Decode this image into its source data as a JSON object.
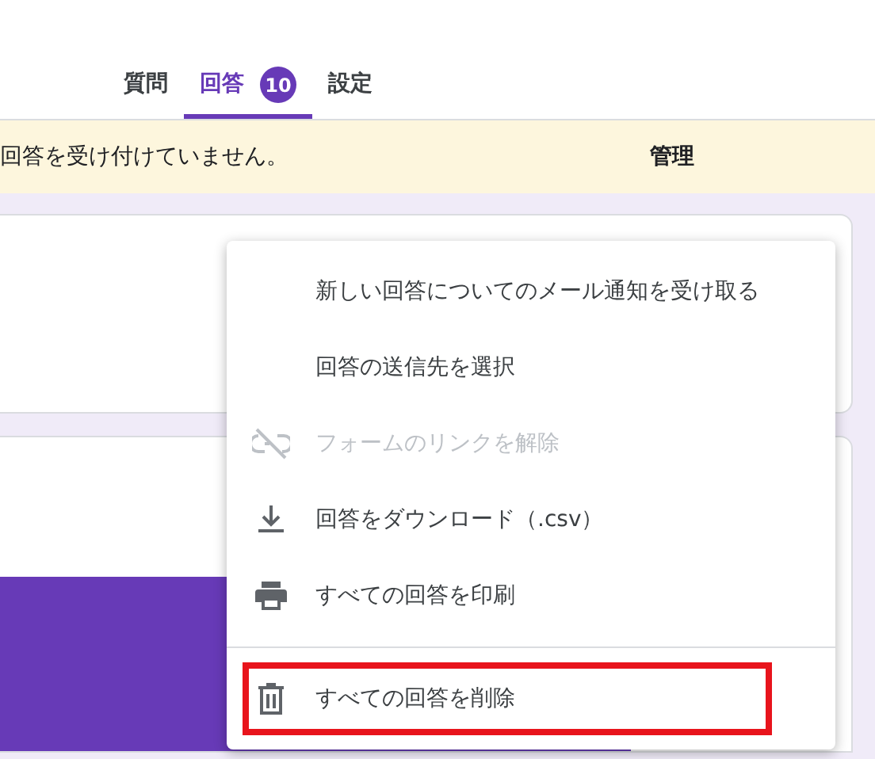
{
  "tabs": [
    {
      "label": "質問",
      "selected": false
    },
    {
      "label": "回答",
      "selected": true,
      "badge": "10"
    },
    {
      "label": "設定",
      "selected": false
    }
  ],
  "banner": {
    "message": "回答を受け付けていません。",
    "action": "管理"
  },
  "menu": {
    "groups": [
      {
        "items": [
          {
            "label": "新しい回答についてのメール通知を受け取る",
            "kind": "plain",
            "disabled": false,
            "highlighted": false
          },
          {
            "label": "回答の送信先を選択",
            "kind": "plain",
            "disabled": false,
            "highlighted": false
          },
          {
            "label": "フォームのリンクを解除",
            "kind": "unlink",
            "disabled": true,
            "highlighted": false
          },
          {
            "label": "回答をダウンロード（.csv）",
            "kind": "download",
            "disabled": false,
            "highlighted": false
          },
          {
            "label": "すべての回答を印刷",
            "kind": "print",
            "disabled": false,
            "highlighted": false
          }
        ]
      },
      {
        "items": [
          {
            "label": "すべての回答を削除",
            "kind": "delete",
            "disabled": false,
            "highlighted": true
          }
        ]
      }
    ]
  }
}
